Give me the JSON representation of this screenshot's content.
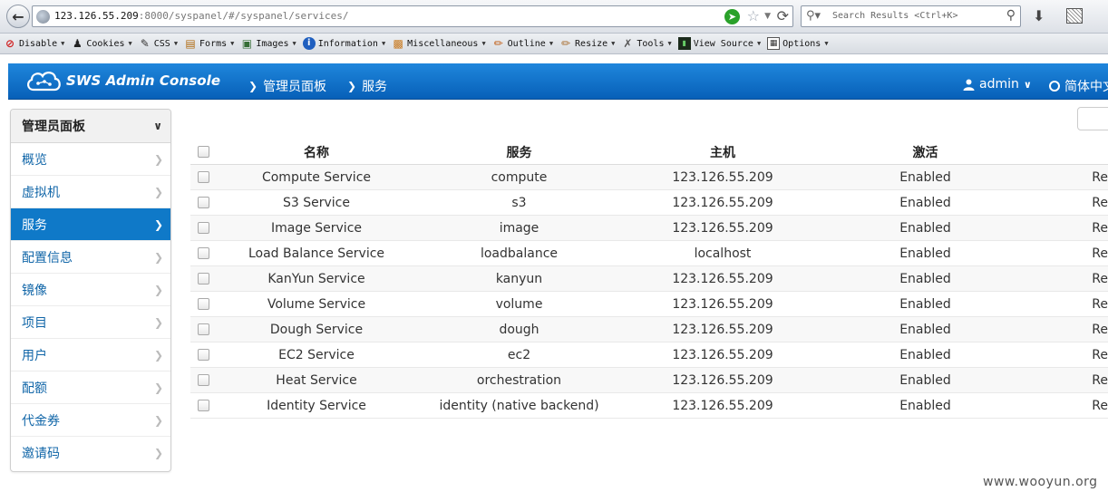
{
  "browser": {
    "url_host": "123.126.55.209",
    "url_path": ":8000/syspanel/#/syspanel/services/",
    "search_placeholder": "Search Results <Ctrl+K>"
  },
  "devtoolbar": {
    "items": [
      "Disable",
      "Cookies",
      "CSS",
      "Forms",
      "Images",
      "Information",
      "Miscellaneous",
      "Outline",
      "Resize",
      "Tools",
      "View Source",
      "Options"
    ]
  },
  "header": {
    "brand": "SWS Admin Console",
    "breadcrumb": [
      "管理员面板",
      "服务"
    ],
    "user": "admin",
    "language": "简体中文"
  },
  "sidebar": {
    "title": "管理员面板",
    "items": [
      "概览",
      "虚拟机",
      "服务",
      "配置信息",
      "镜像",
      "项目",
      "用户",
      "配额",
      "代金券",
      "邀请码"
    ],
    "active_index": 2
  },
  "table": {
    "columns": [
      "名称",
      "服务",
      "主机",
      "激活"
    ],
    "rows": [
      {
        "name": "Compute Service",
        "service": "compute",
        "host": "123.126.55.209",
        "status": "Enabled",
        "extra": "Re"
      },
      {
        "name": "S3 Service",
        "service": "s3",
        "host": "123.126.55.209",
        "status": "Enabled",
        "extra": "Re"
      },
      {
        "name": "Image Service",
        "service": "image",
        "host": "123.126.55.209",
        "status": "Enabled",
        "extra": "Re"
      },
      {
        "name": "Load Balance Service",
        "service": "loadbalance",
        "host": "localhost",
        "status": "Enabled",
        "extra": "Re"
      },
      {
        "name": "KanYun Service",
        "service": "kanyun",
        "host": "123.126.55.209",
        "status": "Enabled",
        "extra": "Re"
      },
      {
        "name": "Volume Service",
        "service": "volume",
        "host": "123.126.55.209",
        "status": "Enabled",
        "extra": "Re"
      },
      {
        "name": "Dough Service",
        "service": "dough",
        "host": "123.126.55.209",
        "status": "Enabled",
        "extra": "Re"
      },
      {
        "name": "EC2 Service",
        "service": "ec2",
        "host": "123.126.55.209",
        "status": "Enabled",
        "extra": "Re"
      },
      {
        "name": "Heat Service",
        "service": "orchestration",
        "host": "123.126.55.209",
        "status": "Enabled",
        "extra": "Re"
      },
      {
        "name": "Identity Service",
        "service": "identity (native backend)",
        "host": "123.126.55.209",
        "status": "Enabled",
        "extra": "Re"
      }
    ]
  },
  "watermark": "www.wooyun.org"
}
